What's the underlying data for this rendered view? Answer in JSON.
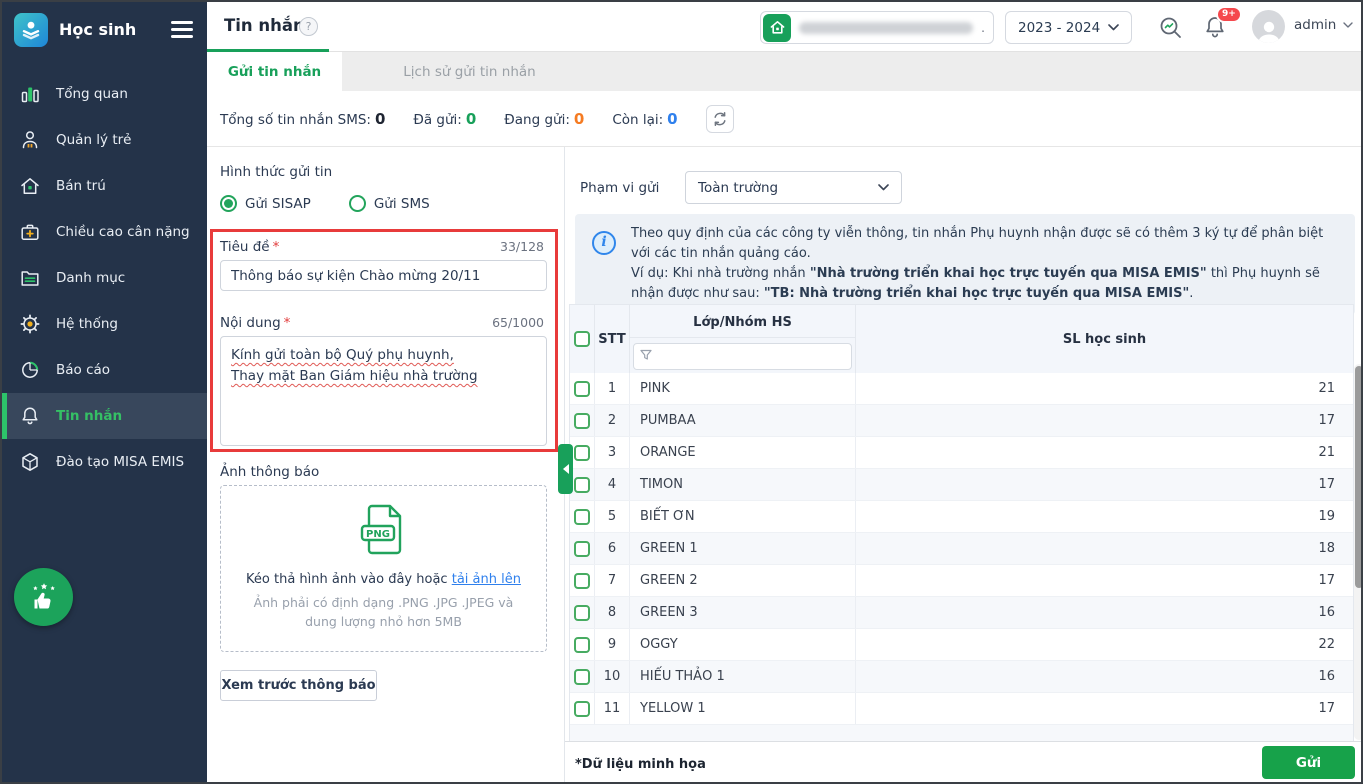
{
  "colors": {
    "primary_green": "#18a05a",
    "accent_orange": "#f57b22",
    "accent_blue": "#2f80ed",
    "highlight_red": "#e83b3b",
    "badge_red": "#f5484d",
    "sidebar_bg": "#243349"
  },
  "sidebar": {
    "app_title": "Học sinh",
    "items": [
      {
        "label": "Tổng quan",
        "icon": "bar-chart-icon"
      },
      {
        "label": "Quản lý trẻ",
        "icon": "person-icon"
      },
      {
        "label": "Bán trú",
        "icon": "house-icon"
      },
      {
        "label": "Chiều cao cân nặng",
        "icon": "suitcase-plus-icon"
      },
      {
        "label": "Danh mục",
        "icon": "folder-icon"
      },
      {
        "label": "Hệ thống",
        "icon": "gear-icon"
      },
      {
        "label": "Báo cáo",
        "icon": "pie-chart-icon"
      },
      {
        "label": "Tin nhắn",
        "icon": "bell-icon",
        "active": true
      },
      {
        "label": "Đào tạo MISA EMIS",
        "icon": "cube-icon"
      }
    ]
  },
  "header": {
    "title": "Tin nhắn",
    "help_glyph": "?",
    "school_year": "2023 - 2024",
    "school_name_hidden_dot": ".",
    "notification_badge": "9+",
    "user": "admin"
  },
  "tabs": [
    {
      "label": "Gửi tin nhắn",
      "active": true
    },
    {
      "label": "Lịch sử gửi tin nhắn",
      "active": false
    }
  ],
  "stats": {
    "total_label": "Tổng số tin nhắn SMS:",
    "total_value": "0",
    "sent_label": "Đã gửi:",
    "sent_value": "0",
    "sending_label": "Đang gửi:",
    "sending_value": "0",
    "remaining_label": "Còn lại:",
    "remaining_value": "0"
  },
  "form": {
    "send_method_label": "Hình thức gửi tin",
    "radio_sisap_label": "Gửi SISAP",
    "radio_sms_label": "Gửi SMS",
    "title_label": "Tiêu đề",
    "title_counter": "33/128",
    "title_value": "Thông báo sự kiện Chào mừng 20/11",
    "content_label": "Nội dung",
    "content_counter": "65/1000",
    "content_line1": "Kính gửi toàn bộ Quý phụ huynh,",
    "content_line2": "Thay mặt Ban Giám hiệu nhà trường",
    "image_label": "Ảnh thông báo",
    "png_badge": "PNG",
    "dropzone_text": "Kéo thả hình ảnh vào đây hoặc",
    "dropzone_link": "tải ảnh lên",
    "dropzone_hint1": "Ảnh phải có định dạng .PNG .JPG .JPEG và",
    "dropzone_hint2": "dung lượng nhỏ hơn 5MB",
    "preview_button": "Xem trước thông báo"
  },
  "recipients": {
    "scope_label": "Phạm vi gửi",
    "scope_value": "Toàn trường",
    "info_line1": "Theo quy định của các công ty viễn thông, tin nhắn Phụ huynh nhận được sẽ có thêm 3 ký tự để phân biệt với các tin nhắn quảng cáo.",
    "info_line2_prefix": "Ví dụ: Khi nhà trường nhắn ",
    "info_bold1": "\"Nhà trường triển khai học trực tuyến qua MISA EMIS\"",
    "info_mid": " thì Phụ huynh sẽ nhận được như sau: ",
    "info_bold2": "\"TB: Nhà trường triển khai học trực tuyến qua MISA EMIS\"",
    "info_suffix": ".",
    "table": {
      "columns": [
        "STT",
        "Lớp/Nhóm HS",
        "SL học sinh"
      ],
      "rows": [
        {
          "stt": 1,
          "name": "PINK",
          "count": 21
        },
        {
          "stt": 2,
          "name": "PUMBAA",
          "count": 17
        },
        {
          "stt": 3,
          "name": "ORANGE",
          "count": 21
        },
        {
          "stt": 4,
          "name": "TIMON",
          "count": 17
        },
        {
          "stt": 5,
          "name": "BIẾT ƠN",
          "count": 19
        },
        {
          "stt": 6,
          "name": "GREEN 1",
          "count": 18
        },
        {
          "stt": 7,
          "name": "GREEN 2",
          "count": 17
        },
        {
          "stt": 8,
          "name": "GREEN 3",
          "count": 16
        },
        {
          "stt": 9,
          "name": "OGGY",
          "count": 22
        },
        {
          "stt": 10,
          "name": "HIẾU THẢO 1",
          "count": 16
        },
        {
          "stt": 11,
          "name": "YELLOW 1",
          "count": 17
        }
      ]
    },
    "footnote": "*Dữ liệu minh họa",
    "send_button": "Gửi"
  }
}
